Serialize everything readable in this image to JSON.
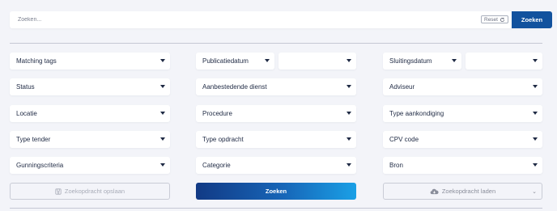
{
  "search": {
    "placeholder": "Zoeken...",
    "reset_label": "Reset",
    "button_label": "Zoeken"
  },
  "filters": {
    "matching_tags": "Matching tags",
    "publicatiedatum": "Publicatiedatum",
    "sluitingsdatum": "Sluitingsdatum",
    "status": "Status",
    "aanbestedende_dienst": "Aanbestedende dienst",
    "adviseur": "Adviseur",
    "locatie": "Locatie",
    "procedure": "Procedure",
    "type_aankondiging": "Type aankondiging",
    "type_tender": "Type tender",
    "type_opdracht": "Type opdracht",
    "cpv_code": "CPV code",
    "gunningscriteria": "Gunningscriteria",
    "categorie": "Categorie",
    "bron": "Bron"
  },
  "actions": {
    "save_label": "Zoekopdracht opslaan",
    "search_label": "Zoeken",
    "load_label": "Zoekopdracht laden"
  },
  "colors": {
    "primary": "#12529e",
    "background": "#f3f4f9"
  }
}
